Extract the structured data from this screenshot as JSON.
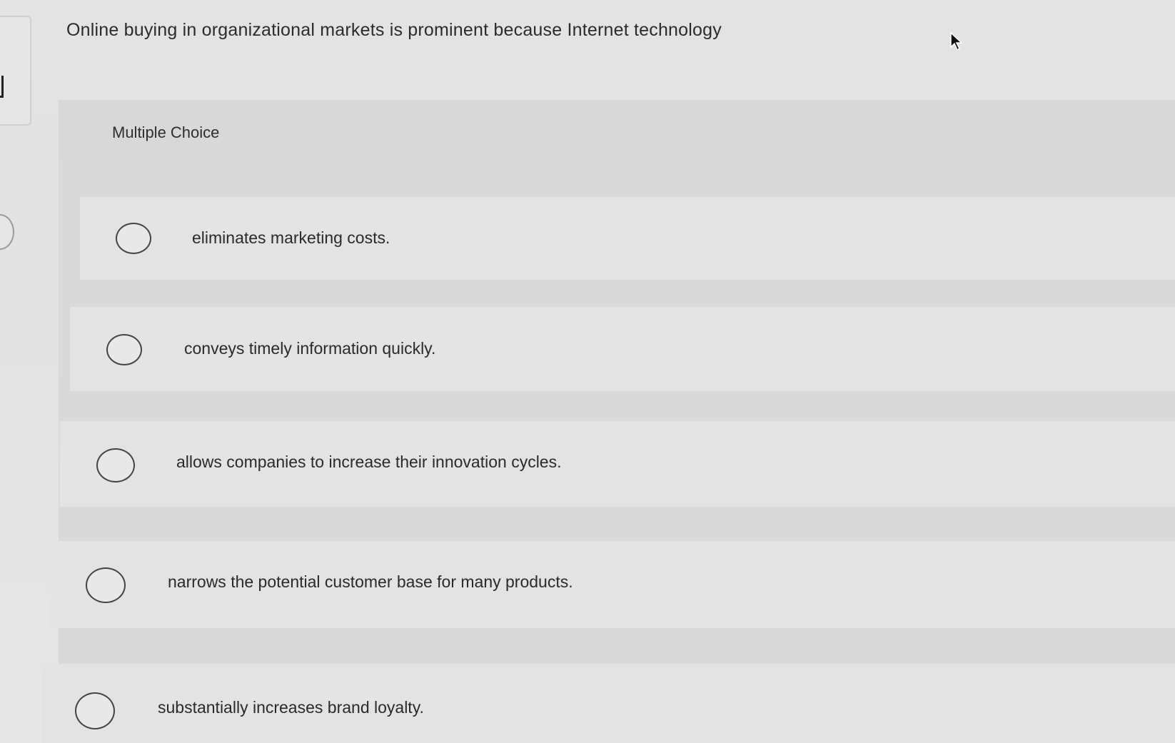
{
  "question": {
    "text": "Online buying in organizational markets is prominent because Internet technology"
  },
  "section": {
    "label": "Multiple Choice"
  },
  "options": [
    {
      "label": "eliminates marketing costs."
    },
    {
      "label": "conveys timely information quickly."
    },
    {
      "label": "allows companies to increase their innovation cycles."
    },
    {
      "label": "narrows the potential customer base for many products."
    },
    {
      "label": "substantially increases brand loyalty."
    }
  ],
  "icons": {
    "cursor": "mouse-pointer-icon",
    "radio": "radio-unselected-icon"
  },
  "colors": {
    "background": "#e2e2e2",
    "panel": "#d9d9d9",
    "option_row": "#e3e3e3",
    "text": "#2a2a2a"
  }
}
